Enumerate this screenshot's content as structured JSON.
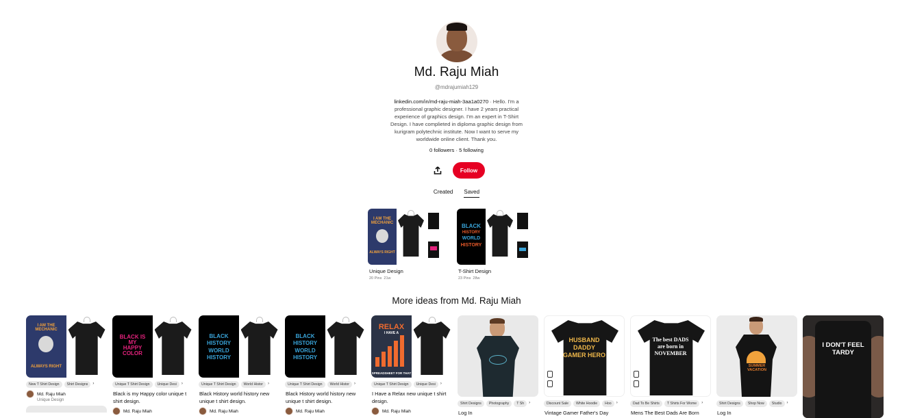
{
  "profile": {
    "name": "Md. Raju Miah",
    "handle": "@mdrajumiah129",
    "link": "linkedin.com/in/md-raju-miah-3aa1a0270",
    "bio": " · Hello. I'm a professional graphic designer. I have 2 years practical experience of graphics design. I'm an expert in T-Shirt Design. I have complieted in diploma graphic design from kurigram polytechnic institute. Now I want to serve my worldwide online client. Thank you.",
    "followers": "0 followers",
    "separator": " · ",
    "following": "5 following",
    "follow_label": "Follow"
  },
  "tabs": [
    {
      "label": "Created",
      "active": false
    },
    {
      "label": "Saved",
      "active": true
    }
  ],
  "boards": [
    {
      "title": "Unique Design",
      "pins": "20 Pins",
      "age": "21w"
    },
    {
      "title": "T-Shirt Design",
      "pins": "23 Pins",
      "age": "28w"
    }
  ],
  "more_title": "More ideas from Md. Raju Miah",
  "pins": [
    {
      "tags": [
        "New T Shirt Design",
        "Shirt Designs"
      ],
      "desc": "",
      "author": "Md. Raju Miah",
      "author_sub": "Unique Design",
      "art_main": "ALWAYS RIGHT",
      "art_top": "I AM THE MECHANIC"
    },
    {
      "tags": [
        "Unique T Shirt Design",
        "Unique Desi"
      ],
      "desc": "Black is my Happy color unique t shirt design.",
      "author": "Md. Raju Miah",
      "art_main": "BLACK IS MY HAPPY COLOR"
    },
    {
      "tags": [
        "Unique T Shirt Design",
        "World Histor"
      ],
      "desc": "Black History world history new unique t shirt design.",
      "author": "Md. Raju Miah",
      "art_main": "BLACK HISTORY WORLD HISTORY"
    },
    {
      "tags": [
        "Unique T Shirt Design",
        "World Histor"
      ],
      "desc": "Black History world history new unique t shirt design.",
      "author": "Md. Raju Miah",
      "art_main": "BLACK HISTORY WORLD HISTORY"
    },
    {
      "tags": [
        "Unique T Shirt Design",
        "Unique Desi"
      ],
      "desc": "I Have a Relax new unique t shirt design.",
      "author": "Md. Raju Miah",
      "art_main": "RELAX",
      "art_top": "I HAVE A",
      "art_bottom": "SPREADSHEET FOR THAT"
    },
    {
      "tags": [
        "Shirt Designs",
        "Photography",
        "T Sh"
      ],
      "desc": "Log In",
      "author": ""
    },
    {
      "tags": [
        "Discount Sale",
        "White Hoodie",
        "Hoo"
      ],
      "desc": "Vintage Gamer Father's Day",
      "author": "",
      "art_main": "HUSBAND DADDY GAMER HERO"
    },
    {
      "tags": [
        "Dad To Be Shirts",
        "T Shirts For Wome"
      ],
      "desc": "Mens The Best Dads Are Born",
      "author": "",
      "art_main": "The best DADS are born in NOVEMBER"
    },
    {
      "tags": [
        "Shirt Designs",
        "Shop Now",
        "Studio"
      ],
      "desc": "Log In",
      "author": "",
      "art_main": "SUMMER VACATION"
    },
    {
      "tags": [],
      "desc": "",
      "author": "",
      "art_main": "I DON'T FEEL TARDY"
    }
  ],
  "colors": {
    "accent": "#e60023"
  }
}
